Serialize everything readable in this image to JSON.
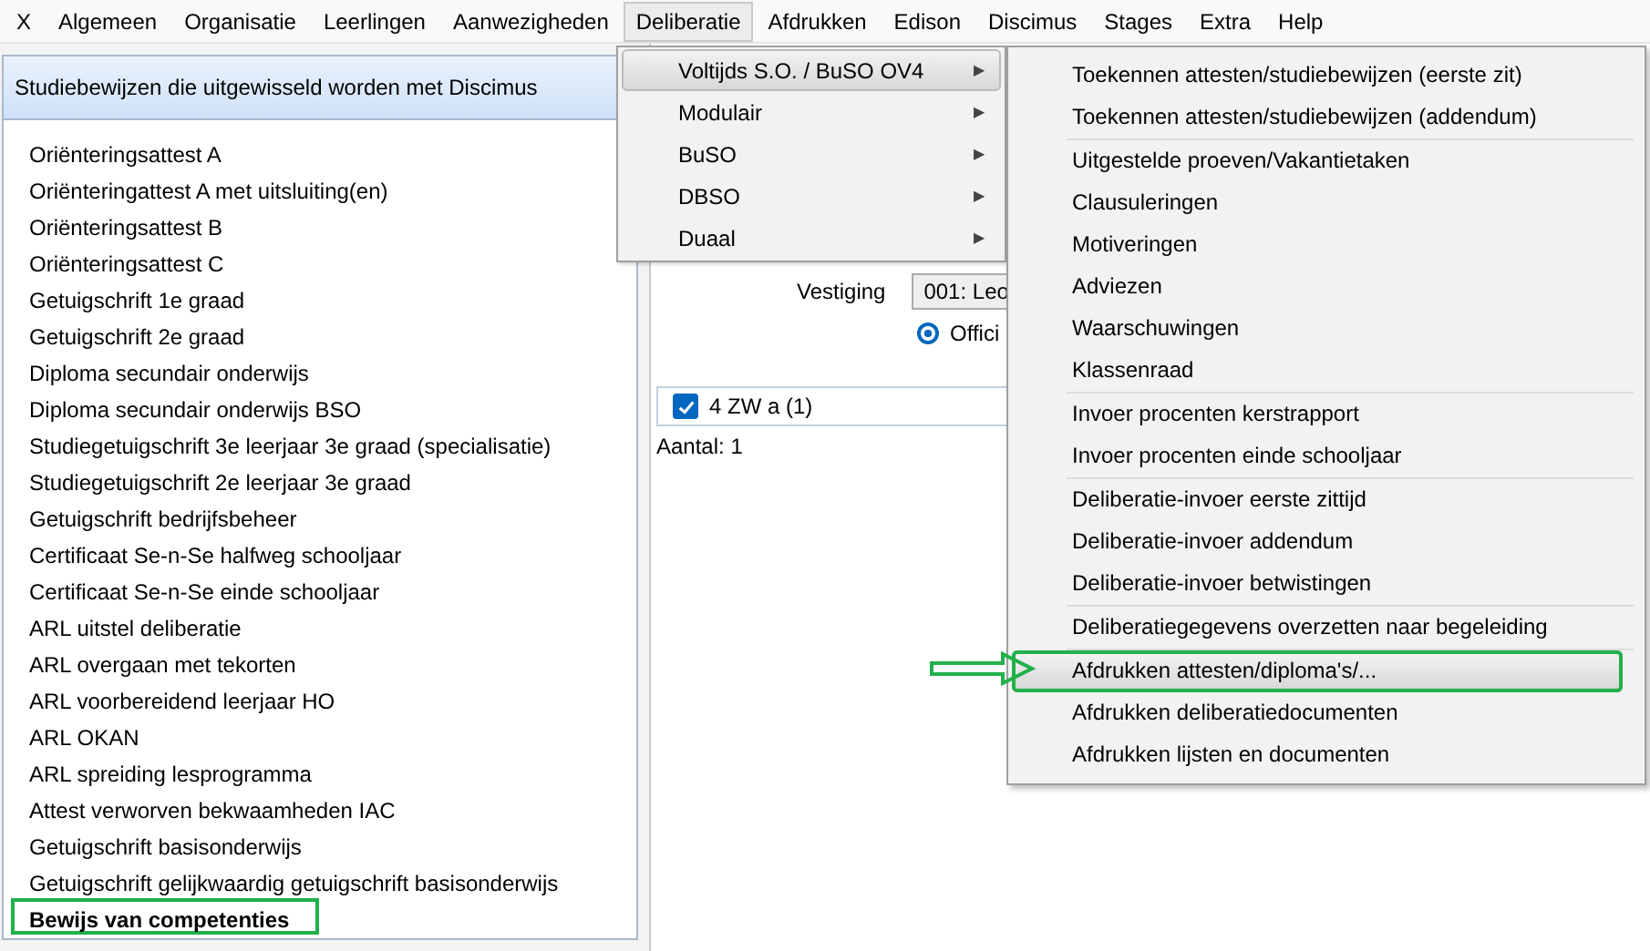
{
  "menu_bar": [
    {
      "label": "X",
      "selected": false
    },
    {
      "label": "Algemeen",
      "selected": false
    },
    {
      "label": "Organisatie",
      "selected": false
    },
    {
      "label": "Leerlingen",
      "selected": false
    },
    {
      "label": "Aanwezigheden",
      "selected": false
    },
    {
      "label": "Deliberatie",
      "selected": true
    },
    {
      "label": "Afdrukken",
      "selected": false
    },
    {
      "label": "Edison",
      "selected": false
    },
    {
      "label": "Discimus",
      "selected": false
    },
    {
      "label": "Stages",
      "selected": false
    },
    {
      "label": "Extra",
      "selected": false
    },
    {
      "label": "Help",
      "selected": false
    }
  ],
  "left_panel": {
    "title": "Studiebewijzen die uitgewisseld worden met Discimus",
    "items": [
      {
        "label": "Oriënteringsattest A",
        "selected": false
      },
      {
        "label": "Oriënteringattest A met uitsluiting(en)",
        "selected": false
      },
      {
        "label": "Oriënteringsattest B",
        "selected": false
      },
      {
        "label": "Oriënteringsattest C",
        "selected": false
      },
      {
        "label": "Getuigschrift 1e graad",
        "selected": false
      },
      {
        "label": "Getuigschrift 2e graad",
        "selected": false
      },
      {
        "label": "Diploma secundair onderwijs",
        "selected": false
      },
      {
        "label": "Diploma secundair onderwijs BSO",
        "selected": false
      },
      {
        "label": "Studiegetuigschrift 3e leerjaar 3e graad (specialisatie)",
        "selected": false
      },
      {
        "label": "Studiegetuigschrift 2e leerjaar 3e graad",
        "selected": false
      },
      {
        "label": "Getuigschrift bedrijfsbeheer",
        "selected": false
      },
      {
        "label": "Certificaat Se-n-Se halfweg schooljaar",
        "selected": false
      },
      {
        "label": "Certificaat Se-n-Se einde schooljaar",
        "selected": false
      },
      {
        "label": "ARL uitstel deliberatie",
        "selected": false
      },
      {
        "label": "ARL overgaan met tekorten",
        "selected": false
      },
      {
        "label": "ARL voorbereidend leerjaar HO",
        "selected": false
      },
      {
        "label": "ARL OKAN",
        "selected": false
      },
      {
        "label": "ARL spreiding lesprogramma",
        "selected": false
      },
      {
        "label": "Attest verworven bekwaamheden IAC",
        "selected": false
      },
      {
        "label": "Getuigschrift basisonderwijs",
        "selected": false
      },
      {
        "label": "Getuigschrift gelijkwaardig getuigschrift basisonderwijs",
        "selected": false
      },
      {
        "label": "Bewijs van competenties",
        "selected": true
      }
    ]
  },
  "form": {
    "vestiging_label": "Vestiging",
    "vestiging_value": "001: Leo",
    "radio_label": "Offici",
    "radio_selected": true,
    "classes": [
      {
        "label": "4 ZW a (1)",
        "checked": true
      }
    ],
    "count": "Aantal: 1"
  },
  "submenu": [
    {
      "label": "Voltijds S.O. / BuSO OV4",
      "selected": true
    },
    {
      "label": "Modulair",
      "selected": false
    },
    {
      "label": "BuSO",
      "selected": false
    },
    {
      "label": "DBSO",
      "selected": false
    },
    {
      "label": "Duaal",
      "selected": false
    }
  ],
  "submenu_arrow": "▶",
  "submenu2_sections": [
    [
      {
        "label": "Toekennen attesten/studiebewijzen (eerste zit)",
        "selected": false
      },
      {
        "label": "Toekennen attesten/studiebewijzen (addendum)",
        "selected": false
      }
    ],
    [
      {
        "label": "Uitgestelde proeven/Vakantietaken",
        "selected": false
      },
      {
        "label": "Clausuleringen",
        "selected": false
      },
      {
        "label": "Motiveringen",
        "selected": false
      },
      {
        "label": "Adviezen",
        "selected": false
      },
      {
        "label": "Waarschuwingen",
        "selected": false
      },
      {
        "label": "Klassenraad",
        "selected": false
      }
    ],
    [
      {
        "label": "Invoer procenten kerstrapport",
        "selected": false
      },
      {
        "label": "Invoer procenten einde schooljaar",
        "selected": false
      }
    ],
    [
      {
        "label": "Deliberatie-invoer eerste zittijd",
        "selected": false
      },
      {
        "label": "Deliberatie-invoer addendum",
        "selected": false
      },
      {
        "label": "Deliberatie-invoer betwistingen",
        "selected": false
      }
    ],
    [
      {
        "label": "Deliberatiegegevens overzetten naar begeleiding",
        "selected": false
      }
    ],
    [
      {
        "label": "Afdrukken attesten/diploma's/...",
        "selected": true
      },
      {
        "label": "Afdrukken deliberatiedocumenten",
        "selected": false
      },
      {
        "label": "Afdrukken lijsten en documenten",
        "selected": false
      }
    ]
  ]
}
